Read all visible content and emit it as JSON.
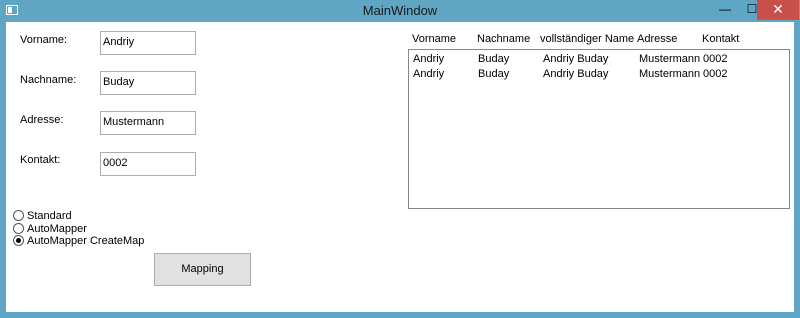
{
  "window": {
    "title": "MainWindow",
    "min": "—",
    "max": "☐",
    "close": "✕"
  },
  "form": {
    "vorname_label": "Vorname:",
    "vorname_value": "Andriy",
    "nachname_label": "Nachname:",
    "nachname_value": "Buday",
    "adresse_label": "Adresse:",
    "adresse_value": "Mustermann",
    "kontakt_label": "Kontakt:",
    "kontakt_value": "0002"
  },
  "options": [
    {
      "label": "Standard",
      "checked": false
    },
    {
      "label": "AutoMapper",
      "checked": false
    },
    {
      "label": "AutoMapper CreateMap",
      "checked": true
    }
  ],
  "mapping_button": "Mapping",
  "list": {
    "columns": [
      "Vorname",
      "Nachname",
      "vollständiger Name",
      "Adresse",
      "Kontakt"
    ],
    "rows": [
      [
        "Andriy",
        "Buday",
        "Andriy Buday",
        "Mustermann",
        "0002"
      ],
      [
        "Andriy",
        "Buday",
        "Andriy Buday",
        "Mustermann",
        "0002"
      ]
    ]
  }
}
